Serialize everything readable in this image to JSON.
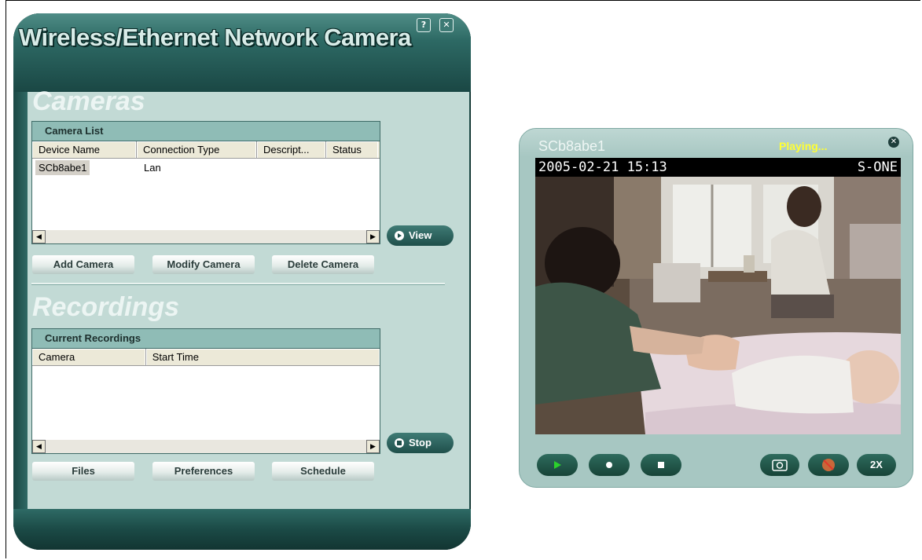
{
  "main_window": {
    "title": "Wireless/Ethernet Network Camera",
    "help_label": "?",
    "close_label": "✕",
    "cameras": {
      "heading": "Cameras",
      "panel_title": "Camera List",
      "columns": [
        "Device Name",
        "Connection Type",
        "Descript...",
        "Status"
      ],
      "rows": [
        {
          "device_name": "SCb8abe1",
          "connection_type": "Lan",
          "description": "",
          "status": ""
        }
      ],
      "view_button": "View",
      "add_button": "Add Camera",
      "modify_button": "Modify Camera",
      "delete_button": "Delete Camera"
    },
    "recordings": {
      "heading": "Recordings",
      "panel_title": "Current Recordings",
      "columns": [
        "Camera",
        "Start Time"
      ],
      "rows": [],
      "stop_button": "Stop",
      "files_button": "Files",
      "preferences_button": "Preferences",
      "schedule_button": "Schedule"
    }
  },
  "viewer": {
    "camera_name": "SCb8abe1",
    "status": "Playing...",
    "close_label": "✕",
    "osd_datetime": "2005-02-21 15:13",
    "osd_brand": "S-ONE",
    "controls": {
      "play_icon": "play-icon",
      "record_icon": "record-icon",
      "stop_icon": "stop-icon",
      "snapshot_icon": "camera-icon",
      "mute_icon": "mute-icon",
      "zoom_label": "2X"
    }
  },
  "colors": {
    "window_dark": "#1d4c48",
    "panel_body": "#c2dad5",
    "panel_title": "#8fbcb6",
    "status_yellow": "#ffff33"
  }
}
